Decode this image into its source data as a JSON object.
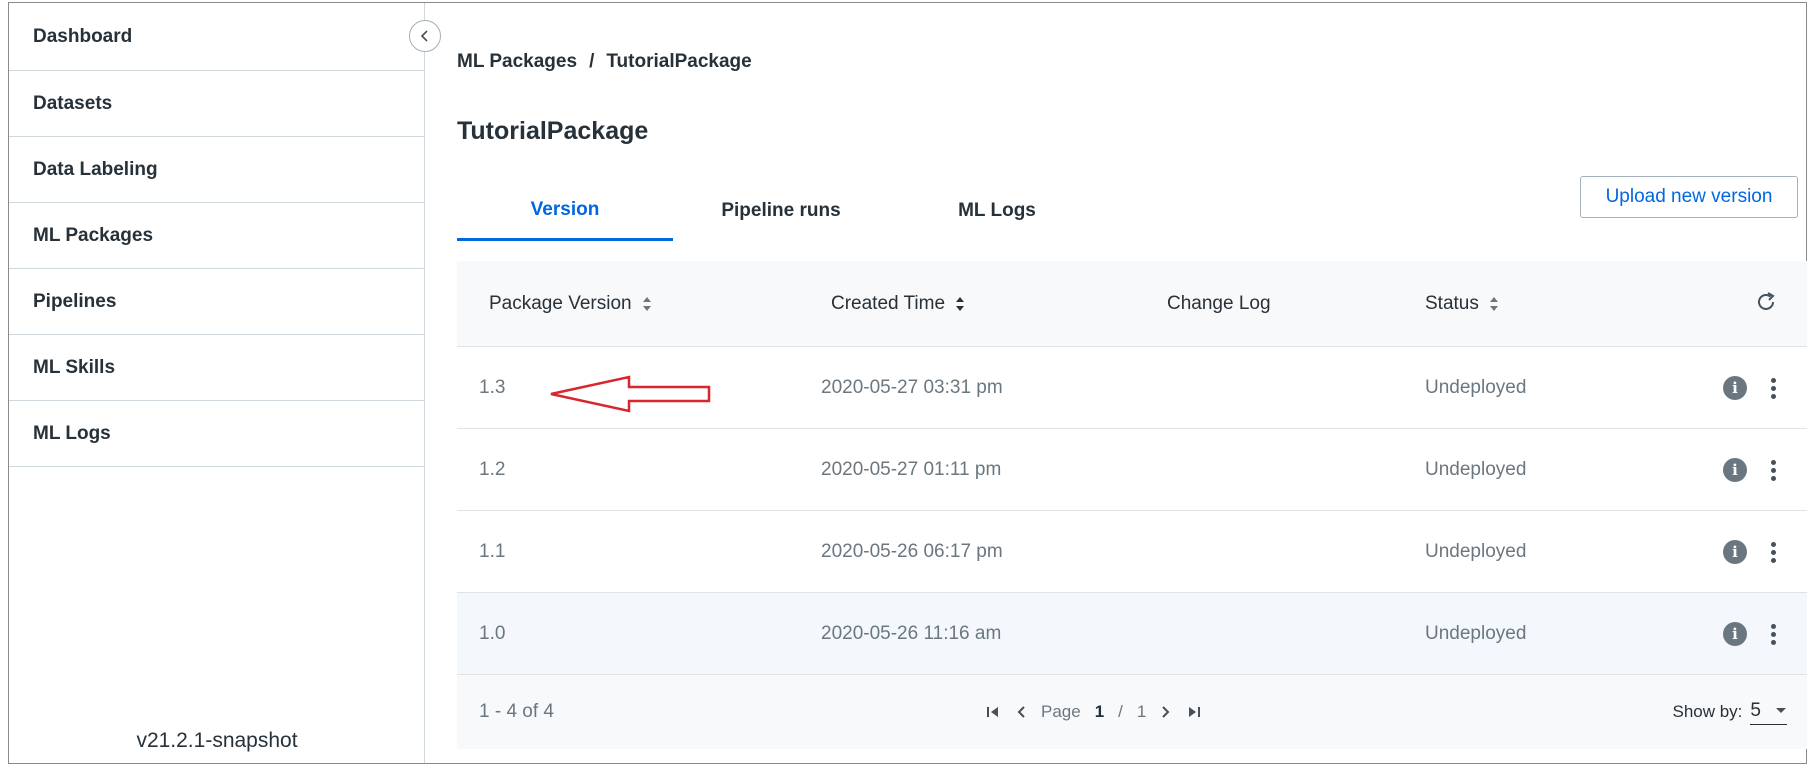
{
  "sidebar": {
    "items": [
      {
        "label": "Dashboard"
      },
      {
        "label": "Datasets"
      },
      {
        "label": "Data Labeling"
      },
      {
        "label": "ML Packages"
      },
      {
        "label": "Pipelines"
      },
      {
        "label": "ML Skills"
      },
      {
        "label": "ML Logs"
      }
    ],
    "version": "v21.2.1-snapshot",
    "collapse_icon": "chevron-left-icon"
  },
  "breadcrumb": {
    "root": "ML Packages",
    "separator": "/",
    "current": "TutorialPackage"
  },
  "page_title": "TutorialPackage",
  "tabs": [
    {
      "label": "Version",
      "active": true
    },
    {
      "label": "Pipeline runs",
      "active": false
    },
    {
      "label": "ML Logs",
      "active": false
    }
  ],
  "upload_button": "Upload new version",
  "table": {
    "columns": [
      "Package Version",
      "Created Time",
      "Change Log",
      "Status"
    ],
    "rows": [
      {
        "version": "1.3",
        "created": "2020-05-27 03:31 pm",
        "change_log": "",
        "status": "Undeployed"
      },
      {
        "version": "1.2",
        "created": "2020-05-27 01:11 pm",
        "change_log": "",
        "status": "Undeployed"
      },
      {
        "version": "1.1",
        "created": "2020-05-26 06:17 pm",
        "change_log": "",
        "status": "Undeployed"
      },
      {
        "version": "1.0",
        "created": "2020-05-26 11:16 am",
        "change_log": "",
        "status": "Undeployed"
      }
    ],
    "info_glyph": "i"
  },
  "footer": {
    "range": "1 - 4 of 4",
    "page_label": "Page",
    "page_current": "1",
    "page_sep": "/",
    "page_total": "1",
    "show_by_label": "Show by:",
    "show_by_value": "5"
  },
  "colors": {
    "accent": "#0067df",
    "annotation_arrow": "#d9262c"
  }
}
